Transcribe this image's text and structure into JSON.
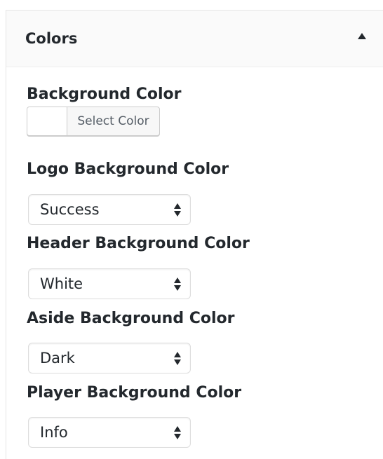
{
  "panel": {
    "title": "Colors",
    "toggle_icon": "triangle-up-icon"
  },
  "fields": {
    "background": {
      "label": "Background Color",
      "button_label": "Select Color",
      "swatch_color": "#ffffff"
    },
    "logo": {
      "label": "Logo Background Color",
      "value": "Success"
    },
    "header": {
      "label": "Header Background Color",
      "value": "White"
    },
    "aside": {
      "label": "Aside Background Color",
      "value": "Dark"
    },
    "player": {
      "label": "Player Background Color",
      "value": "Info"
    }
  }
}
